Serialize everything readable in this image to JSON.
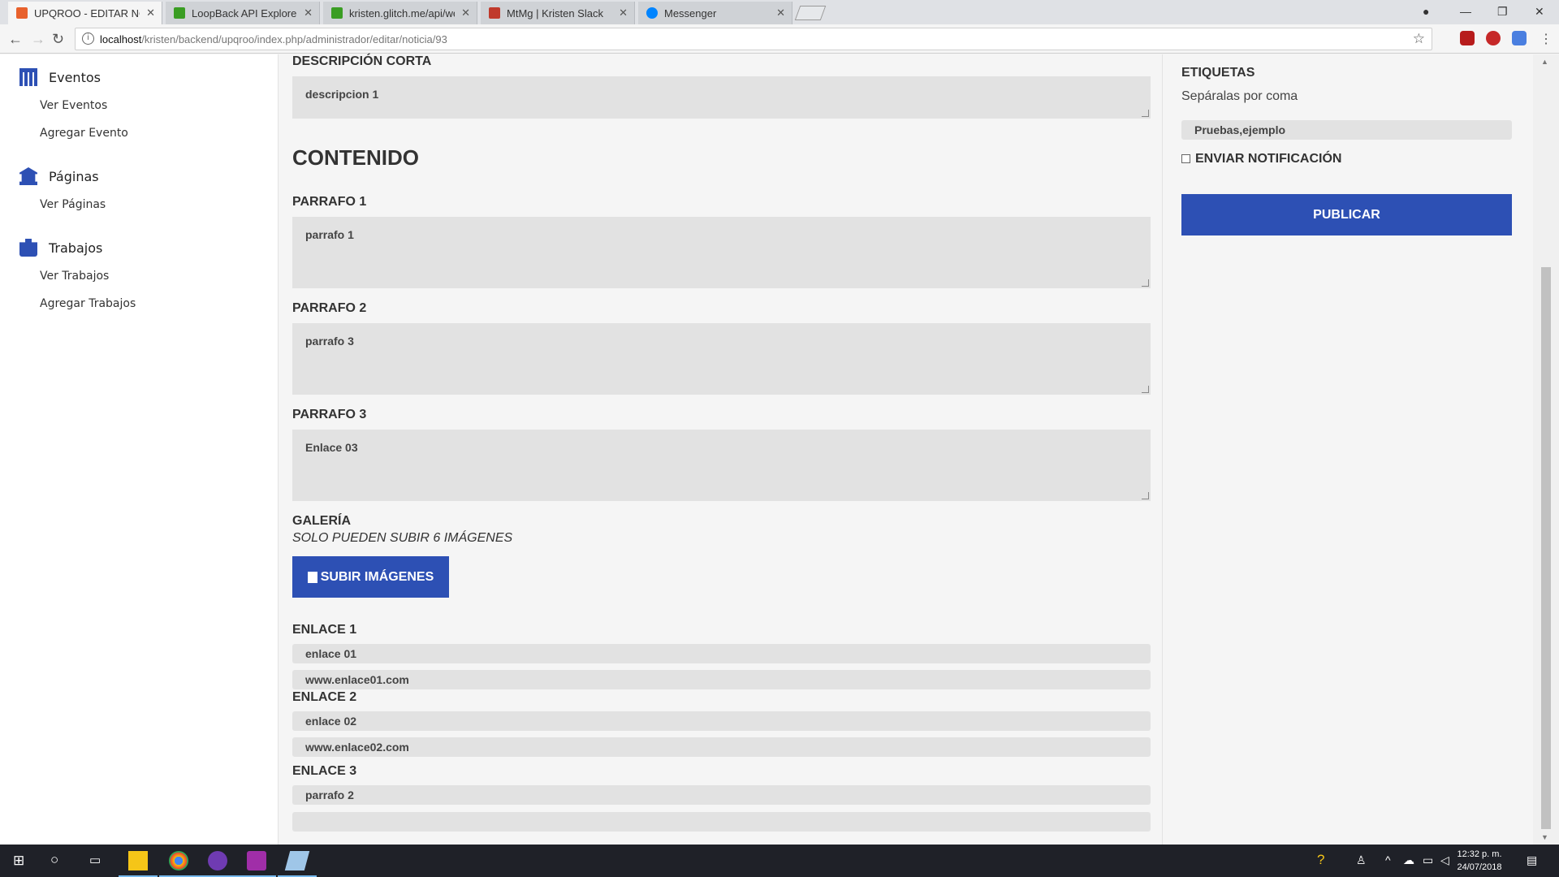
{
  "browser": {
    "tabs": [
      {
        "title": "UPQROO - EDITAR NOTI",
        "active": true,
        "favicon_color": "#e8612c"
      },
      {
        "title": "LoopBack API Explorer",
        "active": false,
        "favicon_color": "#3a9d23"
      },
      {
        "title": "kristen.glitch.me/api/web",
        "active": false,
        "favicon_color": "#3a9d23"
      },
      {
        "title": "MtMg | Kristen Slack",
        "active": false,
        "favicon_color": "#c0392b"
      },
      {
        "title": "Messenger",
        "active": false,
        "favicon_color": "#0084ff"
      }
    ],
    "url_host": "localhost",
    "url_path": "/kristen/backend/upqroo/index.php/administrador/editar/noticia/93"
  },
  "sidebar": {
    "sections": [
      {
        "title": "Eventos",
        "icon": "calendar-icon",
        "links": [
          "Ver Eventos",
          "Agregar Evento"
        ]
      },
      {
        "title": "Páginas",
        "icon": "bank-icon",
        "links": [
          "Ver Páginas"
        ]
      },
      {
        "title": "Trabajos",
        "icon": "briefcase-icon",
        "links": [
          "Ver Trabajos",
          "Agregar Trabajos"
        ]
      }
    ]
  },
  "main": {
    "descripcion_label": "DESCRIPCIÓN CORTA",
    "descripcion_value": "descripcion 1",
    "contenido_heading": "CONTENIDO",
    "parrafos": [
      {
        "label": "PARRAFO 1",
        "value": "parrafo 1"
      },
      {
        "label": "PARRAFO 2",
        "value": "parrafo 3"
      },
      {
        "label": "PARRAFO 3",
        "value": "Enlace 03"
      }
    ],
    "galeria_label": "GALERÍA",
    "galeria_note": "SOLO PUEDEN SUBIR 6 IMÁGENES",
    "subir_button": "SUBIR IMÁGENES",
    "enlaces": [
      {
        "label": "ENLACE 1",
        "text": "enlace 01",
        "url": "www.enlace01.com"
      },
      {
        "label": "ENLACE 2",
        "text": "enlace 02",
        "url": "www.enlace02.com"
      },
      {
        "label": "ENLACE 3",
        "text": "parrafo 2",
        "url": ""
      }
    ]
  },
  "right": {
    "etiquetas_label": "ETIQUETAS",
    "etiquetas_hint": "Sepáralas por coma",
    "etiquetas_value": "Pruebas,ejemplo",
    "notificacion_label": "ENVIAR NOTIFICACIÓN",
    "notificacion_checked": false,
    "publicar_button": "PUBLICAR"
  },
  "taskbar": {
    "time": "12:32 p. m.",
    "date": "24/07/2018"
  },
  "colors": {
    "accent": "#2d50b4"
  }
}
